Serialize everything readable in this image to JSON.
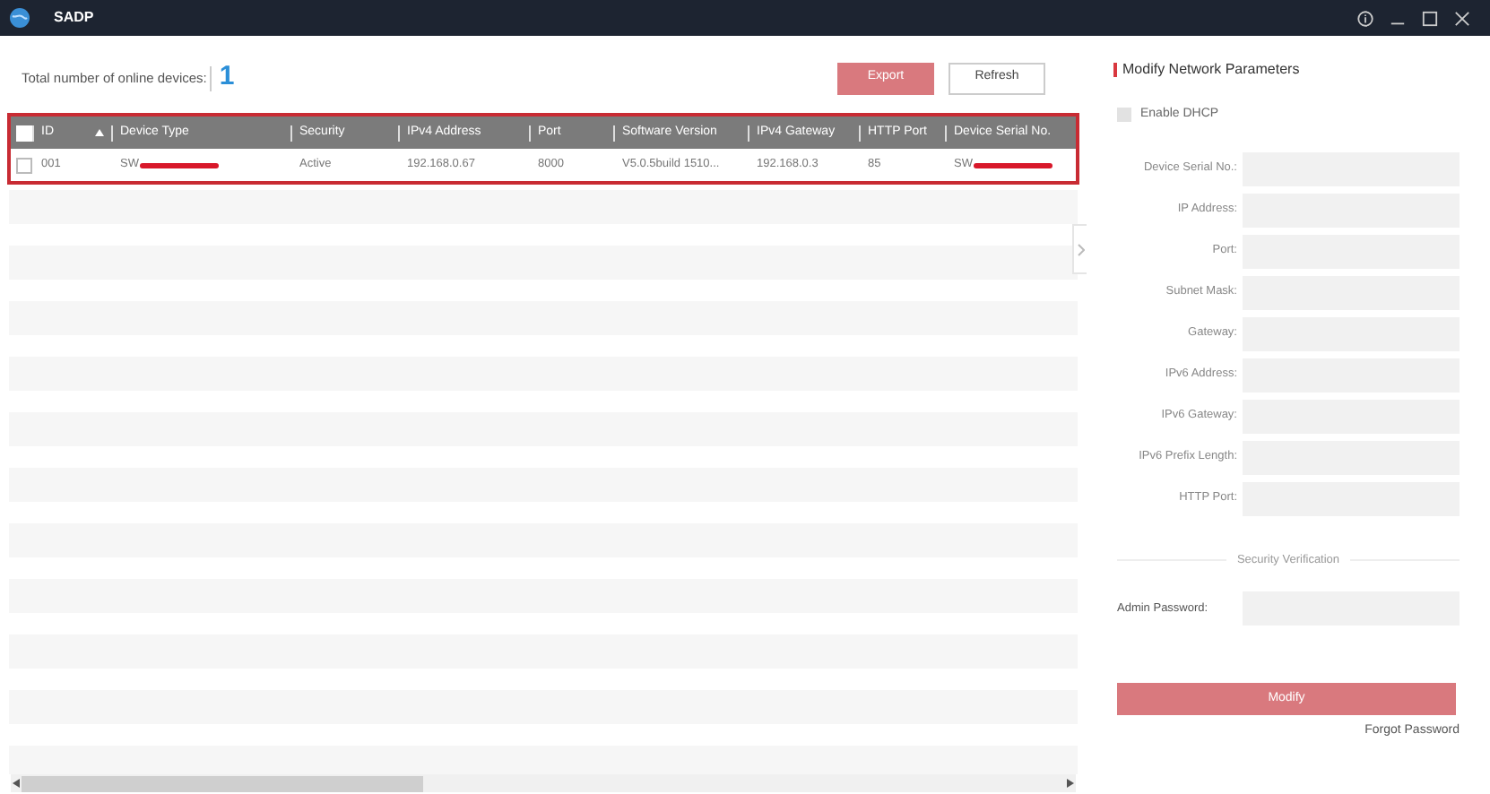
{
  "window": {
    "title": "SADP"
  },
  "summary": {
    "label": "Total number of online devices:",
    "count": "1"
  },
  "toolbar": [
    {
      "label": "Export",
      "disabled": true
    },
    {
      "label": "Refresh",
      "disabled": false
    }
  ],
  "table": {
    "all_checked": false,
    "columns": [
      {
        "label": "ID",
        "sorted": true
      },
      {
        "label": "Device Type",
        "sorted": false
      },
      {
        "label": "Security",
        "sorted": false
      },
      {
        "label": "IPv4 Address",
        "sorted": false
      },
      {
        "label": "Port",
        "sorted": false
      },
      {
        "label": "Software Version",
        "sorted": false
      },
      {
        "label": "IPv4 Gateway",
        "sorted": false
      },
      {
        "label": "HTTP Port",
        "sorted": false
      },
      {
        "label": "Device Serial No.",
        "sorted": false
      }
    ],
    "rows": [
      {
        "checked": false,
        "cells": [
          {
            "text": "001",
            "redacted": false
          },
          {
            "text": "SW",
            "redacted": true
          },
          {
            "text": "Active",
            "redacted": false
          },
          {
            "text": "192.168.0.67",
            "redacted": false
          },
          {
            "text": "8000",
            "redacted": false
          },
          {
            "text": "V5.0.5build 1510...",
            "redacted": false
          },
          {
            "text": "192.168.0.3",
            "redacted": false
          },
          {
            "text": "85",
            "redacted": false
          },
          {
            "text": "SW",
            "redacted": true
          }
        ]
      }
    ]
  },
  "panel": {
    "title": "Modify Network Parameters",
    "dhcp": {
      "label": "Enable DHCP",
      "checked": false
    },
    "fields": [
      {
        "label": "Device Serial No.:"
      },
      {
        "label": "IP Address:"
      },
      {
        "label": "Port:"
      },
      {
        "label": "Subnet Mask:"
      },
      {
        "label": "Gateway:"
      },
      {
        "label": "IPv6 Address:"
      },
      {
        "label": "IPv6 Gateway:"
      },
      {
        "label": "IPv6 Prefix Length:"
      },
      {
        "label": "HTTP Port:"
      }
    ],
    "security_heading": "Security Verification",
    "password_label": "Admin Password:",
    "submit": {
      "label": "Modify",
      "disabled": true
    },
    "forgot_link": "Forgot Password"
  }
}
